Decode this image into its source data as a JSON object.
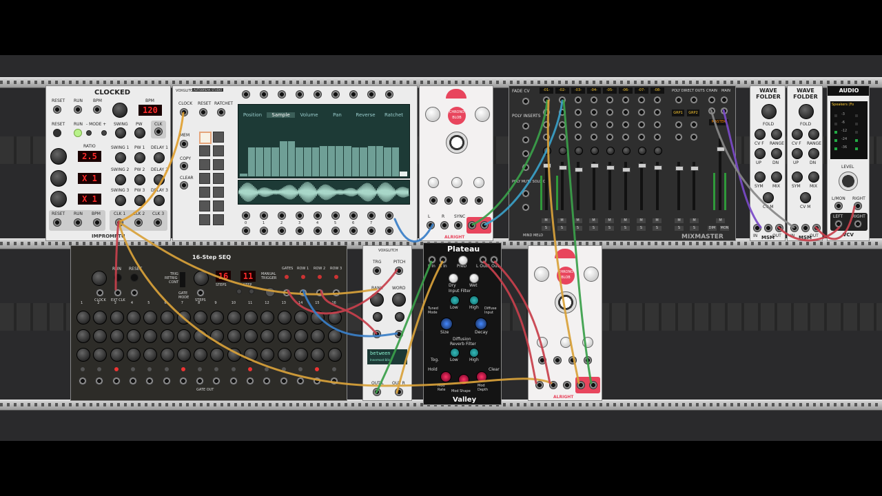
{
  "clocked": {
    "title": "CLOCKED",
    "brand": "IMPROMPTU",
    "labels": {
      "reset": "RESET",
      "run": "RUN",
      "bpm": "BPM",
      "bpm2": "BPM",
      "mode": "- MODE +",
      "swing": "SWING",
      "pw": "PW",
      "clk": "CLK",
      "ratio": "RATIO",
      "swing1": "SWING 1",
      "pw1": "PW 1",
      "delay1": "DELAY 1",
      "swing2": "SWING 2",
      "pw2": "PW 2",
      "delay2": "DELAY 2",
      "swing3": "SWING 3",
      "pw3": "PW 3",
      "delay3": "DELAY 3",
      "clk1": "CLK 1",
      "clk2": "CLK 2",
      "clk3": "CLK 3"
    },
    "bpm_display": "120",
    "ratio1": "2.5",
    "ratio2": "X 1",
    "ratio3": "X 1"
  },
  "sampler": {
    "brand": "VOXGLITCH",
    "subtitle": "AUTOBREAK STUDIO",
    "labels": {
      "clock": "CLOCK",
      "reset": "RESET",
      "ratchet": "RATCHET",
      "mem": "MEM",
      "copy": "COPY",
      "clear": "CLEAR"
    },
    "tabs": [
      "Position",
      "Sample",
      "Volume",
      "Pan",
      "Reverse",
      "Ratchet"
    ],
    "active_tab": "Sample",
    "bars": [
      0.05,
      0.48,
      0.48,
      0.48,
      0.48,
      0.58,
      0.58,
      0.48,
      0.48,
      0.48,
      0.5,
      0.5,
      0.5,
      0.5,
      0.48,
      0.48,
      0.5,
      0.5,
      0.48,
      0.48,
      0.08
    ],
    "input_numbers": [
      "0",
      "1",
      "2",
      "3",
      "4",
      "5",
      "6",
      "7"
    ]
  },
  "chronoblob": {
    "brand": "ALRIGHT",
    "logo": "CHRONO BLOB",
    "labels": {
      "sync": "SYNC",
      "l": "L",
      "r": "R"
    }
  },
  "mixer": {
    "brand": "MIND MELD",
    "name": "MIXMASTER",
    "channels": [
      "-01-",
      "-02-",
      "-03-",
      "-04-",
      "-05-",
      "-06-",
      "-07-",
      "-08-"
    ],
    "side_labels": [
      "FADE CV",
      "POLY INSERTS",
      "POLY MUTE SOLO CV"
    ],
    "grp": [
      "GRP1",
      "GRP2"
    ],
    "poly_direct": "POLY DIRECT OUTS",
    "chain": "CHAIN",
    "main": "MAIN",
    "master": "MASTER",
    "m": "M",
    "s": "S",
    "dim": "DIM",
    "mon": "MON"
  },
  "wavefolder": {
    "title": "WAVE FOLDER",
    "brand": "MSM",
    "labels": {
      "fold": "FOLD",
      "cvf": "CV F",
      "range": "RANGE",
      "up": "UP",
      "dn": "DN",
      "sym": "SYM",
      "mix": "MIX",
      "cvm": "CV M",
      "in": "IN",
      "out": "OUT"
    }
  },
  "audio": {
    "title": "AUDIO",
    "device": "Speakers (Fo",
    "level": "LEVEL",
    "lmon": "L/MON",
    "right": "RIGHT",
    "left": "LEFT",
    "right2": "RIGHT",
    "brand": "VCV",
    "db": [
      "-3",
      "-6",
      "-12",
      "-24",
      "-36"
    ]
  },
  "seq": {
    "title": "16-Step SEQ",
    "labels": {
      "run": "RUN",
      "reset": "RESET",
      "clock": "CLOCK",
      "extclk": "EXT CLK",
      "trig": "TRIG",
      "retrig": "RETRIG",
      "cont": "CONT",
      "gatemode": "GATE MODE",
      "steps": "STEPS",
      "step": "STEP",
      "manual": "MANUAL TRIGGER",
      "gates": "GATES",
      "row1": "ROW 1",
      "row2": "ROW 2",
      "row3": "ROW 3",
      "gateout": "GATE OUT"
    },
    "steps_display": "16",
    "step_display": "11",
    "numbers": [
      "1",
      "2",
      "3",
      "4",
      "5",
      "6",
      "7",
      "8",
      "9",
      "10",
      "11",
      "12",
      "13",
      "14",
      "15",
      "16"
    ]
  },
  "glitch": {
    "brand": "VOXGLITCH",
    "labels": {
      "trg": "TRG",
      "pitch": "PITCH",
      "bank": "BANK",
      "word": "WORD",
      "outl": "OUT L",
      "outr": "OUT R"
    },
    "display": "between",
    "display2": "Innermost 8/in"
  },
  "plateau": {
    "title": "Plateau",
    "footer": "Valley",
    "labels": {
      "lin": "L In",
      "rin": "R In",
      "predelay": "PreD",
      "dry": "Dry",
      "wet": "Wet",
      "lout": "L Out",
      "rout": "R Out",
      "inputfilter": "Input Filter",
      "low": "Low",
      "high": "High",
      "tuned": "Tuned Mode",
      "diffuse": "Diffuse Input",
      "size": "Size",
      "decay": "Decay",
      "diffusion": "Diffusion",
      "reverbfilter": "Reverb Filter",
      "hold": "Hold",
      "clear": "Clear",
      "modrate": "Mod Rate",
      "modshape": "Mod Shape",
      "moddepth": "Mod Depth",
      "tog": "Tog."
    }
  },
  "chronoblob2": {
    "brand": "ALRIGHT",
    "logo": "CHRONO BLOB"
  }
}
